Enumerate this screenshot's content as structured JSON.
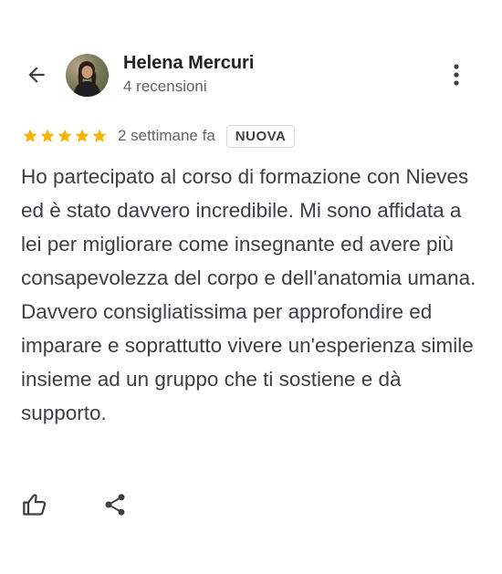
{
  "header": {
    "back_icon": "arrow-back-icon",
    "more_icon": "more-vert-icon"
  },
  "reviewer": {
    "name": "Helena Mercuri",
    "review_count": "4 recensioni"
  },
  "review": {
    "rating": 5,
    "max_rating": 5,
    "date": "2 settimane fa",
    "badge": "NUOVA",
    "text": "Ho partecipato al corso di formazione con Nieves ed è stato davvero incredibile. Mi sono affidata a lei per migliorare come insegnante ed avere più consapevolezza del corpo e dell'anatomia umana. Davvero consigliatissima per approfondire ed imparare e soprattutto vivere un'esperienza simile insieme ad un gruppo che ti sostiene e dà supporto."
  },
  "actions": {
    "like_icon": "thumb-up-icon",
    "share_icon": "share-icon"
  },
  "colors": {
    "star": "#f4b400",
    "text": "#3c4043",
    "secondary_text": "#5f6368",
    "icon": "#3c4043"
  }
}
